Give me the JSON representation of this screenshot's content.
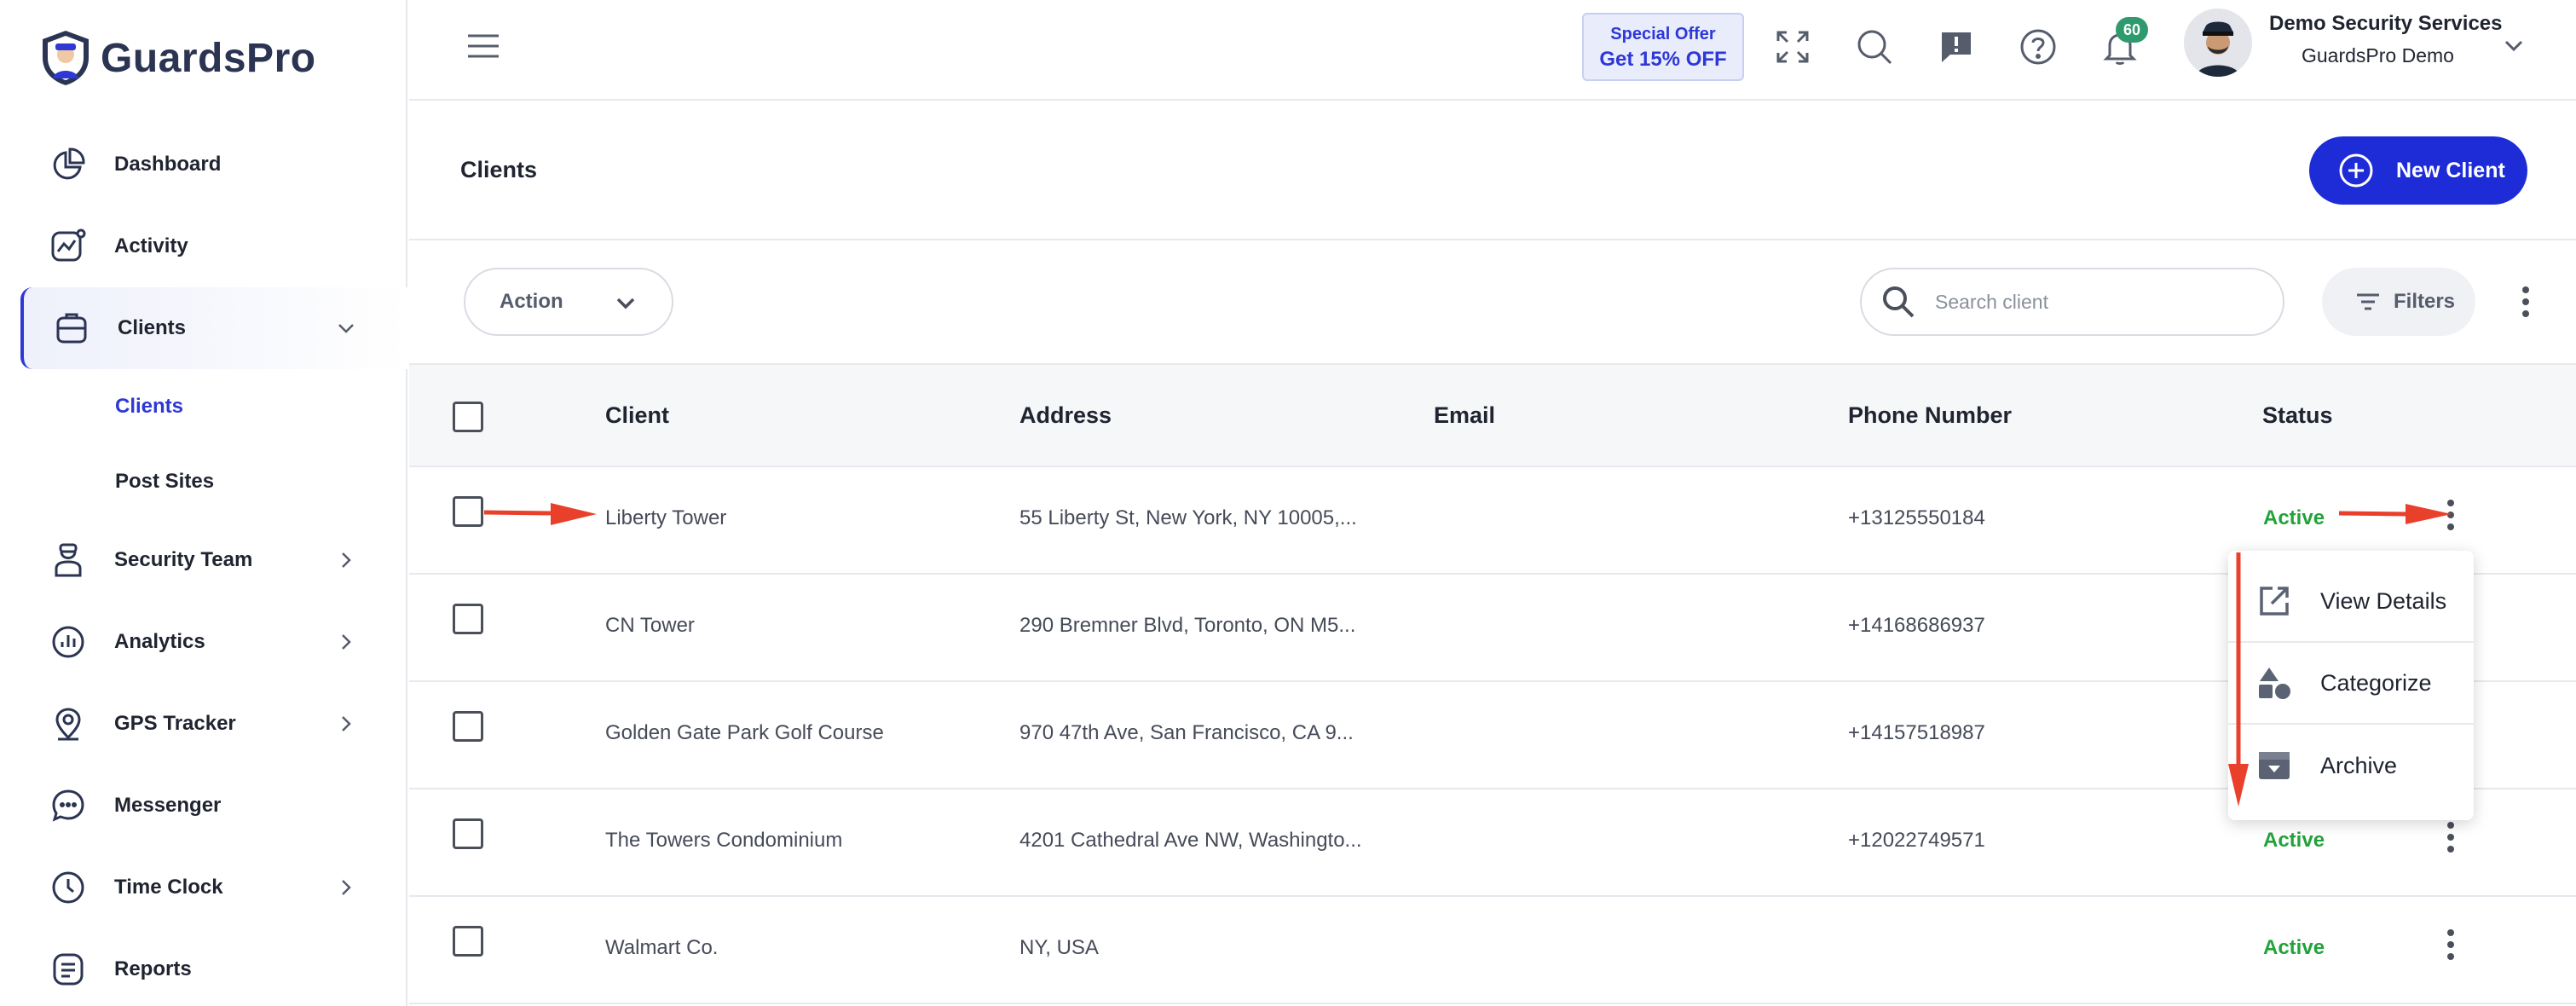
{
  "app": {
    "brand": "GuardsPro"
  },
  "sidebar": {
    "items": [
      {
        "label": "Dashboard",
        "icon": "pie-chart-icon"
      },
      {
        "label": "Activity",
        "icon": "activity-chart-icon"
      },
      {
        "label": "Clients",
        "icon": "briefcase-icon",
        "active": true
      },
      {
        "label": "Security Team",
        "icon": "guard-icon"
      },
      {
        "label": "Analytics",
        "icon": "analytics-icon"
      },
      {
        "label": "GPS Tracker",
        "icon": "location-pin-icon"
      },
      {
        "label": "Messenger",
        "icon": "chat-bubble-icon"
      },
      {
        "label": "Time Clock",
        "icon": "clock-icon"
      },
      {
        "label": "Reports",
        "icon": "report-icon"
      }
    ],
    "sub_items": [
      {
        "label": "Clients",
        "current": true
      },
      {
        "label": "Post Sites"
      }
    ]
  },
  "topbar": {
    "offer_line1": "Special Offer",
    "offer_line2": "Get 15% OFF",
    "notification_count": "60",
    "user_name": "Demo Security Services",
    "user_org": "GuardsPro Demo"
  },
  "page": {
    "title": "Clients",
    "new_client_label": "New Client"
  },
  "toolbar": {
    "action_label": "Action",
    "search_placeholder": "Search client",
    "filters_label": "Filters"
  },
  "table": {
    "columns": [
      "Client",
      "Address",
      "Email",
      "Phone Number",
      "Status"
    ],
    "rows": [
      {
        "client": "Liberty Tower",
        "address": "55 Liberty St, New York, NY 10005,...",
        "email": "",
        "phone": "+13125550184",
        "status": "Active"
      },
      {
        "client": "CN Tower",
        "address": "290 Bremner Blvd, Toronto, ON M5...",
        "email": "",
        "phone": "+14168686937",
        "status": ""
      },
      {
        "client": "Golden Gate Park Golf Course",
        "address": "970 47th Ave, San Francisco, CA 9...",
        "email": "",
        "phone": "+14157518987",
        "status": ""
      },
      {
        "client": "The Towers Condominium",
        "address": "4201 Cathedral Ave NW, Washingto...",
        "email": "",
        "phone": "+12022749571",
        "status": "Active"
      },
      {
        "client": "Walmart Co.",
        "address": "NY, USA",
        "email": "",
        "phone": "",
        "status": "Active"
      }
    ]
  },
  "row_menu": {
    "items": [
      {
        "label": "View Details",
        "icon": "external-link-icon"
      },
      {
        "label": "Categorize",
        "icon": "shapes-icon"
      },
      {
        "label": "Archive",
        "icon": "archive-box-icon"
      }
    ]
  },
  "colors": {
    "primary": "#1e2cd8",
    "active_status": "#22a23a",
    "badge": "#2e9a6e",
    "annotation_arrow": "#e8402a"
  }
}
